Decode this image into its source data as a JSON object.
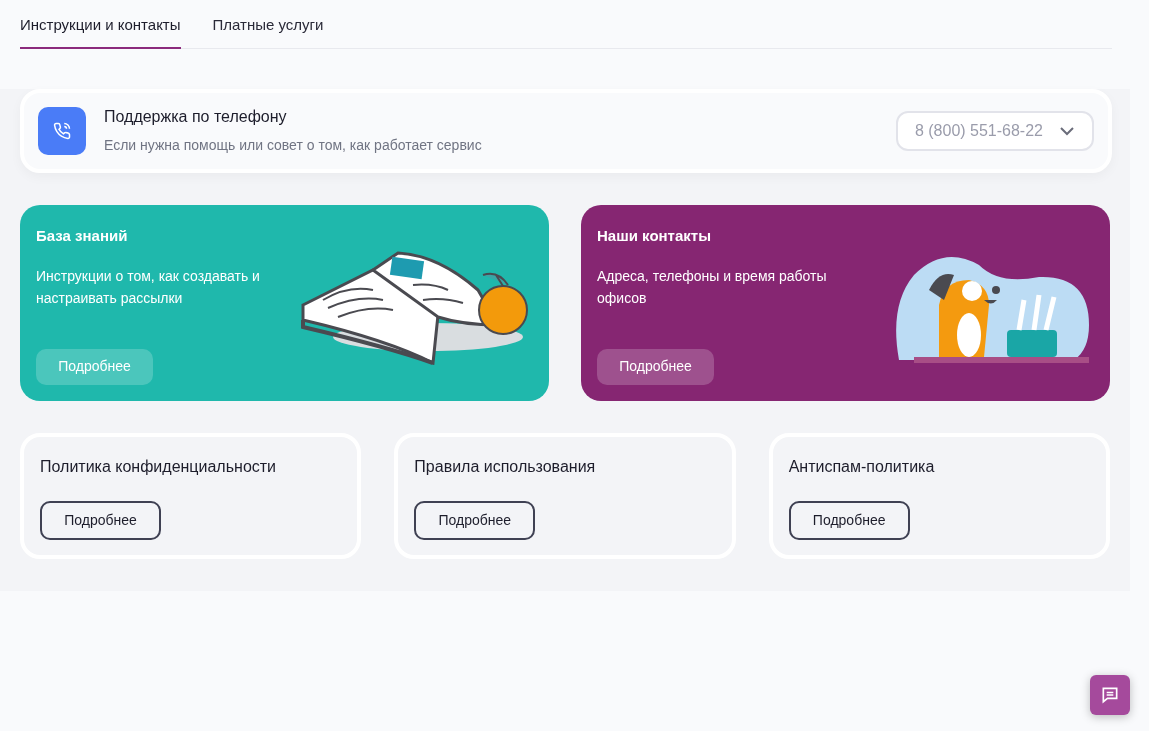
{
  "tabs": [
    {
      "label": "Инструкции и контакты",
      "selected": true
    },
    {
      "label": "Платные услуги",
      "selected": false
    }
  ],
  "support": {
    "title": "Поддержка по телефону",
    "subtitle": "Если нужна помощь или совет о том, как работает сервис",
    "phone": "8 (800) 551-68-22"
  },
  "feature_cards": [
    {
      "kind": "knowledge",
      "title": "База знаний",
      "text": "Инструкции о том, как создавать и настраивать рассылки",
      "button": "Подробнее",
      "color": "#1fb8ac"
    },
    {
      "kind": "contacts",
      "title": "Наши контакты",
      "text": "Адреса, телефоны и время работы офисов",
      "button": "Подробнее",
      "color": "#862672"
    }
  ],
  "policy_cards": [
    {
      "title": "Политика конфиденциальности",
      "button": "Подробнее"
    },
    {
      "title": "Правила использования",
      "button": "Подробнее"
    },
    {
      "title": "Антиспам-политика",
      "button": "Подробнее"
    }
  ]
}
